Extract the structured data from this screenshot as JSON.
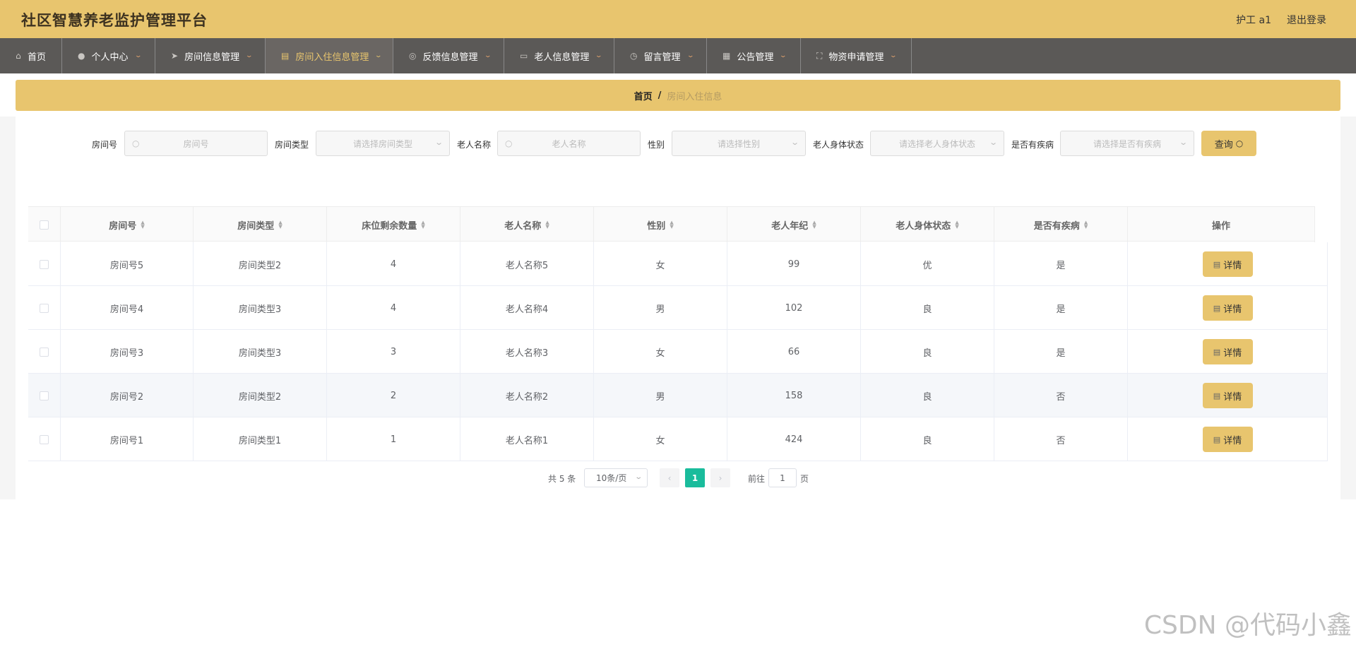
{
  "header": {
    "title": "社区智慧养老监护管理平台",
    "user": "护工 a1",
    "logout": "退出登录"
  },
  "nav": [
    {
      "label": "首页",
      "icon": "home-icon",
      "glyph": "⌂",
      "caret": false,
      "active": false
    },
    {
      "label": "个人中心",
      "icon": "user-icon",
      "glyph": "●",
      "caret": true,
      "active": false
    },
    {
      "label": "房间信息管理",
      "icon": "send-icon",
      "glyph": "➤",
      "caret": true,
      "active": false
    },
    {
      "label": "房间入住信息管理",
      "icon": "clipboard-icon",
      "glyph": "▤",
      "caret": true,
      "active": true
    },
    {
      "label": "反馈信息管理",
      "icon": "target-icon",
      "glyph": "◎",
      "caret": true,
      "active": false
    },
    {
      "label": "老人信息管理",
      "icon": "message-icon",
      "glyph": "▭",
      "caret": true,
      "active": false
    },
    {
      "label": "留言管理",
      "icon": "clock-icon",
      "glyph": "◷",
      "caret": true,
      "active": false
    },
    {
      "label": "公告管理",
      "icon": "grid-icon",
      "glyph": "▦",
      "caret": true,
      "active": false
    },
    {
      "label": "物资申请管理",
      "icon": "fullscreen-icon",
      "glyph": "⛶",
      "caret": true,
      "active": false
    }
  ],
  "breadcrumb": {
    "home": "首页",
    "sep": "/",
    "current": "房间入住信息"
  },
  "filters": {
    "room_no": {
      "label": "房间号",
      "placeholder": "房间号"
    },
    "room_type": {
      "label": "房间类型",
      "placeholder": "请选择房间类型"
    },
    "elder_name": {
      "label": "老人名称",
      "placeholder": "老人名称"
    },
    "gender": {
      "label": "性别",
      "placeholder": "请选择性别"
    },
    "health": {
      "label": "老人身体状态",
      "placeholder": "请选择老人身体状态"
    },
    "disease": {
      "label": "是否有疾病",
      "placeholder": "请选择是否有疾病"
    },
    "query": "查询"
  },
  "table": {
    "columns": [
      "房间号",
      "房间类型",
      "床位剩余数量",
      "老人名称",
      "性别",
      "老人年纪",
      "老人身体状态",
      "是否有疾病",
      "操作"
    ],
    "rows": [
      [
        "房间号5",
        "房间类型2",
        "4",
        "老人名称5",
        "女",
        "99",
        "优",
        "是"
      ],
      [
        "房间号4",
        "房间类型3",
        "4",
        "老人名称4",
        "男",
        "102",
        "良",
        "是"
      ],
      [
        "房间号3",
        "房间类型3",
        "3",
        "老人名称3",
        "女",
        "66",
        "良",
        "是"
      ],
      [
        "房间号2",
        "房间类型2",
        "2",
        "老人名称2",
        "男",
        "158",
        "良",
        "否"
      ],
      [
        "房间号1",
        "房间类型1",
        "1",
        "老人名称1",
        "女",
        "424",
        "良",
        "否"
      ]
    ],
    "detail": "详情"
  },
  "pagination": {
    "total": "共 5 条",
    "page_size": "10条/页",
    "current": "1",
    "goto": "前往",
    "goto_value": "1",
    "page_unit": "页"
  },
  "watermark": "CSDN @代码小鑫",
  "colors": {
    "accent": "#e8c56e",
    "nav": "#5b5957",
    "active_page": "#1abc9c"
  }
}
